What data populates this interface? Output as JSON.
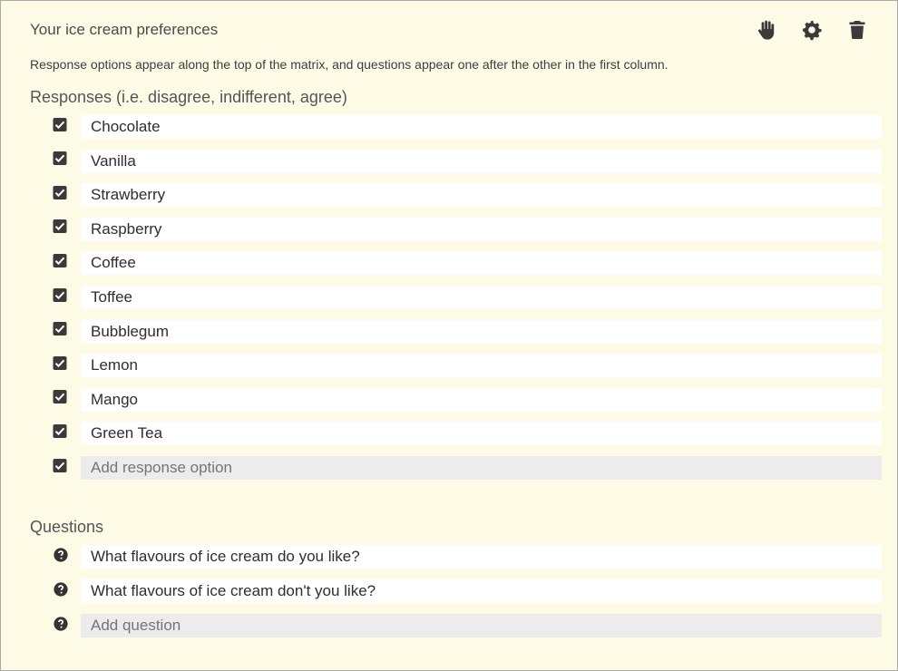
{
  "panel": {
    "title": "Your ice cream preferences",
    "help_text": "Response options appear along the top of the matrix, and questions appear one after the other in the first column.",
    "tools": [
      "hand-icon",
      "gear-icon",
      "trash-icon"
    ]
  },
  "responses": {
    "heading": "Responses (i.e. disagree, indifferent, agree)",
    "items": [
      {
        "label": "Chocolate",
        "checked": true
      },
      {
        "label": "Vanilla",
        "checked": true
      },
      {
        "label": "Strawberry",
        "checked": true
      },
      {
        "label": "Raspberry",
        "checked": true
      },
      {
        "label": "Coffee",
        "checked": true
      },
      {
        "label": "Toffee",
        "checked": true
      },
      {
        "label": "Bubblegum",
        "checked": true
      },
      {
        "label": "Lemon",
        "checked": true
      },
      {
        "label": "Mango",
        "checked": true
      },
      {
        "label": "Green Tea",
        "checked": true
      }
    ],
    "add_placeholder": "Add response option"
  },
  "questions": {
    "heading": "Questions",
    "items": [
      {
        "label": "What flavours of ice cream do you like?"
      },
      {
        "label": "What flavours of ice cream don't you like?"
      }
    ],
    "add_placeholder": "Add question"
  },
  "colors": {
    "panel_bg": "#fdfbe6",
    "field_bg": "#ffffff",
    "add_field_bg": "#ececec",
    "icon": "#3a3a3a"
  }
}
